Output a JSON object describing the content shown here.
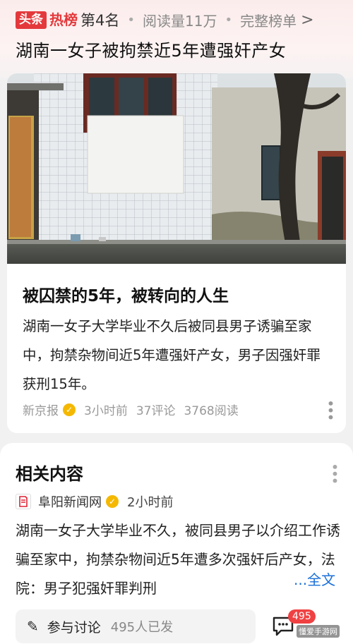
{
  "header": {
    "brand_logo": "头条",
    "brand_hot": "热榜",
    "rank": "第4名",
    "reads": "阅读量11万",
    "full_list": "完整榜单",
    "headline": "湖南一女子被拘禁近5年遭强奸产女"
  },
  "card": {
    "title": "被囚禁的5年，被转向的人生",
    "body": "湖南一女子大学毕业不久后被同县男子诱骗至家中，拘禁杂物间近5年遭强奸产女，男子因强奸罪获刑15年。",
    "source": "新京报",
    "time": "3小时前",
    "comments": "37评论",
    "reads": "3768阅读"
  },
  "related": {
    "title": "相关内容",
    "source": "阜阳新闻网",
    "time": "2小时前",
    "body": "湖南一女子大学毕业不久，被同县男子以介绍工作诱骗至家中，拘禁杂物间近5年遭多次强奸后产女，法院：男子犯强奸罪判刑",
    "full_link": "...全文"
  },
  "bottom": {
    "discuss_label": "参与讨论",
    "discuss_count": "495人已发",
    "comment_badge": "495",
    "watermark": "懂爱手游网"
  },
  "icons": {
    "verify": "verified-badge-icon",
    "more": "more-vertical-icon",
    "pencil": "pencil-icon",
    "comment": "comment-bubble-icon",
    "chevron": "chevron-right-icon"
  },
  "colors": {
    "brand_red": "#e4393c",
    "link_blue": "#1a6fd8",
    "verify_gold": "#f5b800",
    "badge_red": "#f04142"
  }
}
